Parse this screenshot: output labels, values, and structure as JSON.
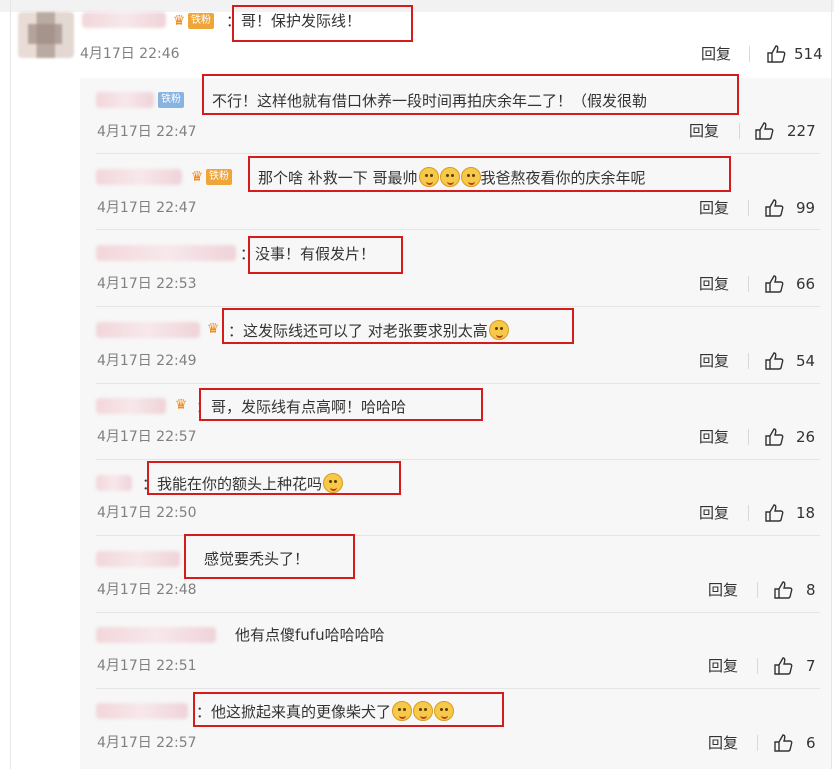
{
  "comments": [
    {
      "text": "：哥！保护发际线！",
      "time": "4月17日 22:46",
      "reply": "回复",
      "likes": "514",
      "badge": "铁粉"
    },
    {
      "text": "不行！这样他就有借口休养一段时间再拍庆余年二了！（假发很勒",
      "time": "4月17日 22:47",
      "reply": "回复",
      "likes": "227",
      "badge": "铁粉"
    },
    {
      "text_a": "那个啥 补救一下 哥最帅",
      "text_b": "我爸熬夜看你的庆余年呢",
      "time": "4月17日 22:47",
      "reply": "回复",
      "likes": "99",
      "badge": "铁粉"
    },
    {
      "text": "：没事！有假发片！",
      "time": "4月17日 22:53",
      "reply": "回复",
      "likes": "66"
    },
    {
      "text": "：这发际线还可以了 对老张要求别太高",
      "time": "4月17日 22:49",
      "reply": "回复",
      "likes": "54"
    },
    {
      "text": "：哥，发际线有点高啊！哈哈哈",
      "time": "4月17日 22:57",
      "reply": "回复",
      "likes": "26"
    },
    {
      "text": "：我能在你的额头上种花吗",
      "time": "4月17日 22:50",
      "reply": "回复",
      "likes": "18"
    },
    {
      "text": "感觉要秃头了！",
      "time": "4月17日 22:48",
      "reply": "回复",
      "likes": "8"
    },
    {
      "text": "他有点傻fufu哈哈哈哈",
      "time": "4月17日 22:51",
      "reply": "回复",
      "likes": "7"
    },
    {
      "text": "：他这掀起来真的更像柴犬了",
      "time": "4月17日 22:57",
      "reply": "回复",
      "likes": "6"
    }
  ],
  "icons": {
    "like": "thumbs-up-icon",
    "emoji": "face-emoji-icon",
    "crown": "crown-icon"
  },
  "colors": {
    "highlight": "#d41c1c",
    "panel": "#f7f7f7"
  }
}
